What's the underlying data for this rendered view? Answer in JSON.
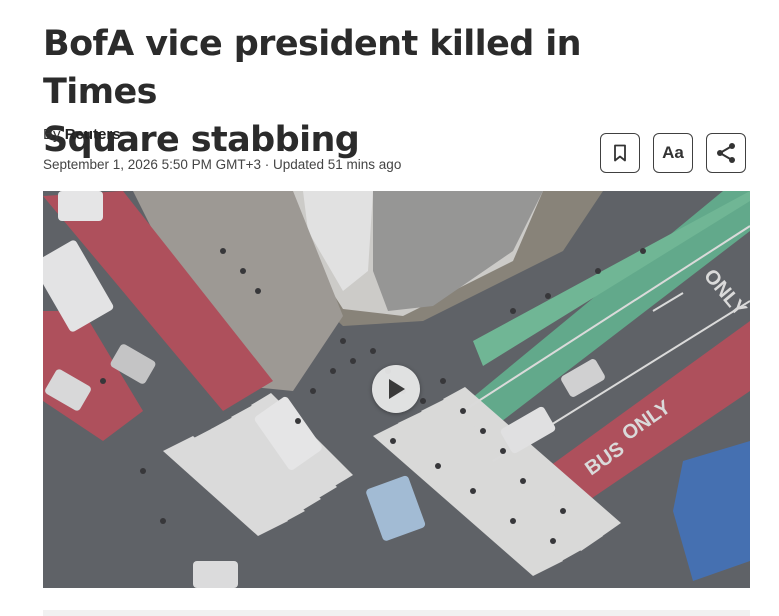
{
  "article": {
    "headline_line1": "BofA vice president killed in Times",
    "headline_line2": "Square stabbing",
    "byline_prefix": "By",
    "author": "Reuters",
    "dateline": "September 1, 2026 5:50 PM GMT+3 · Updated 51 mins ago"
  },
  "toolbar": {
    "bookmark_icon": "bookmark-icon",
    "text_size_label": "Aa",
    "share_icon": "share-icon"
  },
  "video": {
    "play_icon": "play-icon",
    "street_marking_only_1": "ONLY",
    "street_marking_only_2": "ONLY",
    "street_marking_bus": "BUS"
  },
  "colors": {
    "headline": "#2b2b2b",
    "bus_lane": "#b54a57",
    "bike_lane": "#5fb08c",
    "asphalt": "#5c5f63"
  }
}
